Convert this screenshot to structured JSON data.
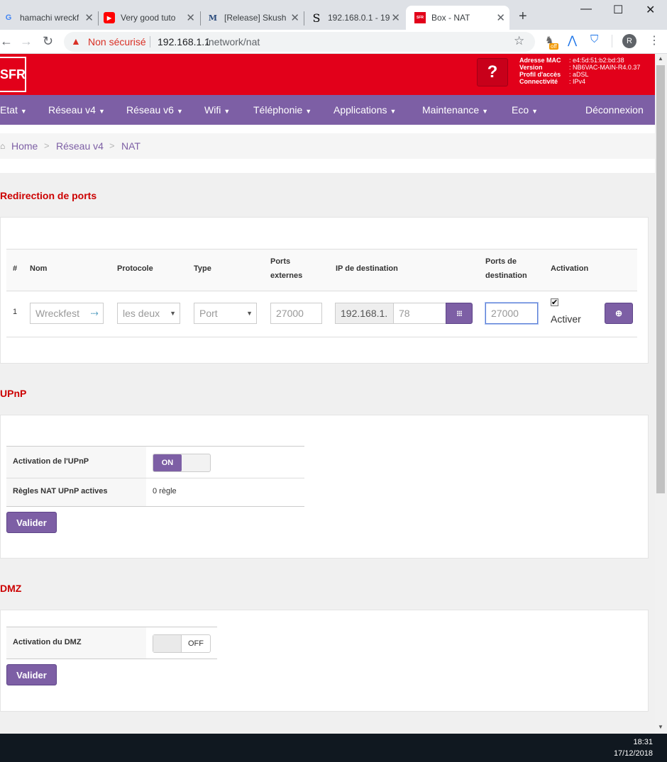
{
  "browser": {
    "tabs": [
      {
        "label": "hamachi wreckf",
        "icon": "google-icon"
      },
      {
        "label": "Very good tuto",
        "icon": "youtube-icon"
      },
      {
        "label": "[Release] Skush",
        "icon": "m-icon"
      },
      {
        "label": "192.168.0.1 - 19",
        "icon": "s-icon"
      },
      {
        "label": "Box - NAT",
        "icon": "sfr-icon",
        "active": true
      }
    ],
    "security_label": "Non sécurisé",
    "url_host": "192.168.1.1",
    "url_path": "/network/nat",
    "profile_initial": "R",
    "ext_badge": "off"
  },
  "header": {
    "logo": "SFR",
    "help": "?",
    "info": [
      {
        "key": "Adresse MAC",
        "value": ": e4:5d:51:b2:bd:38"
      },
      {
        "key": "Version",
        "value": ": NB6VAC-MAIN-R4.0.37"
      },
      {
        "key": "Profil d'accès",
        "value": ": aDSL"
      },
      {
        "key": "Connectivité",
        "value": ": IPv4"
      }
    ]
  },
  "nav": {
    "items": [
      "Etat",
      "Réseau v4",
      "Réseau v6",
      "Wifi",
      "Téléphonie",
      "Applications",
      "Maintenance",
      "Eco"
    ],
    "logout": "Déconnexion"
  },
  "breadcrumb": {
    "home": "Home",
    "level1": "Réseau v4",
    "current": "NAT"
  },
  "ports": {
    "title": "Redirection de ports",
    "headers": {
      "num": "#",
      "name": "Nom",
      "proto": "Protocole",
      "type": "Type",
      "ext1": "Ports",
      "ext2": "externes",
      "ip": "IP de destination",
      "dst1": "Ports de",
      "dst2": "destination",
      "act": "Activation"
    },
    "row": {
      "num": "1",
      "name_placeholder": "Wreckfest",
      "proto": "les deux",
      "type": "Port",
      "ext_port": "27000",
      "ip_prefix": "192.168.1.",
      "ip_suffix": "78",
      "dst_port": "27000",
      "activer": "Activer"
    }
  },
  "upnp": {
    "title": "UPnP",
    "rows": [
      {
        "label": "Activation de l'UPnP",
        "value": "ON"
      },
      {
        "label": "Règles NAT UPnP actives",
        "value": "0 règle"
      }
    ],
    "submit": "Valider"
  },
  "dmz": {
    "title": "DMZ",
    "rows": [
      {
        "label": "Activation du DMZ",
        "value": "OFF"
      }
    ],
    "submit": "Valider"
  },
  "taskbar": {
    "time": "18:31",
    "date": "17/12/2018"
  }
}
